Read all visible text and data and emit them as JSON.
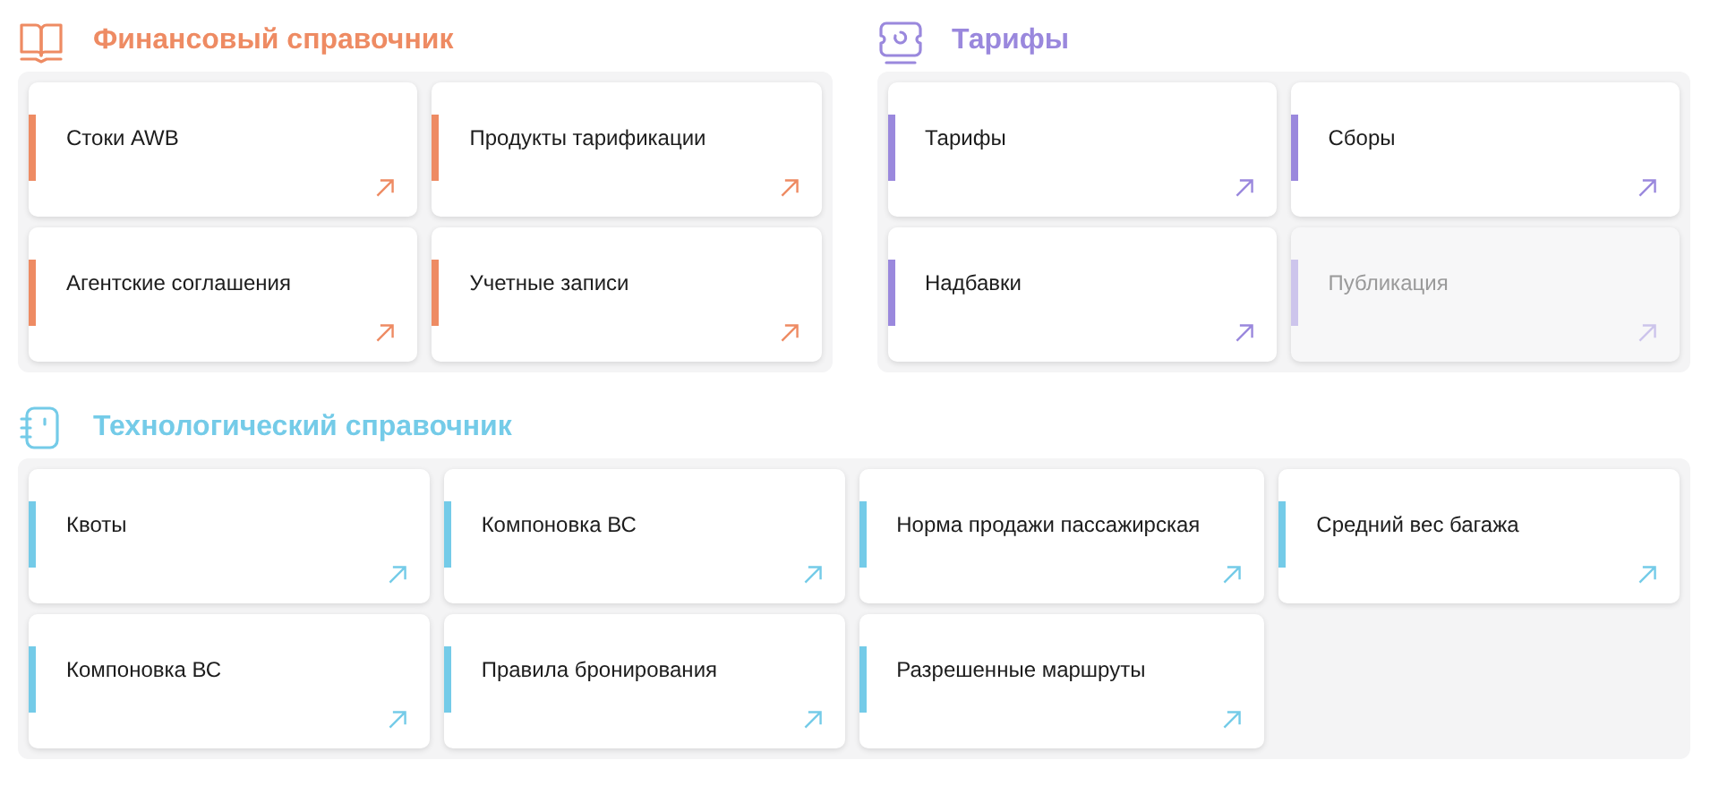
{
  "top_sections": [
    {
      "title": "Финансовый справочник",
      "color": "#ee8b63",
      "cards": [
        {
          "label": "Стоки AWB",
          "disabled": false
        },
        {
          "label": "Продукты тарификации",
          "disabled": false
        },
        {
          "label": "Агентские соглашения",
          "disabled": false
        },
        {
          "label": "Учетные записи",
          "disabled": false
        }
      ]
    },
    {
      "title": "Тарифы",
      "color": "#9a88dd",
      "cards": [
        {
          "label": "Тарифы",
          "disabled": false
        },
        {
          "label": "Сборы",
          "disabled": false
        },
        {
          "label": "Надбавки",
          "disabled": false
        },
        {
          "label": "Публикация",
          "disabled": true
        }
      ]
    }
  ],
  "bottom_section": {
    "title": "Технологический справочник",
    "color": "#74cbe8",
    "cards": [
      {
        "label": "Квоты",
        "disabled": false
      },
      {
        "label": "Компоновка ВС",
        "disabled": false
      },
      {
        "label": "Норма продажи пассажирская",
        "disabled": false
      },
      {
        "label": "Средний вес багажа",
        "disabled": false
      },
      {
        "label": "Компоновка ВС",
        "disabled": false
      },
      {
        "label": "Правила бронирования",
        "disabled": false
      },
      {
        "label": "Разрешенные маршруты",
        "disabled": false
      }
    ]
  }
}
